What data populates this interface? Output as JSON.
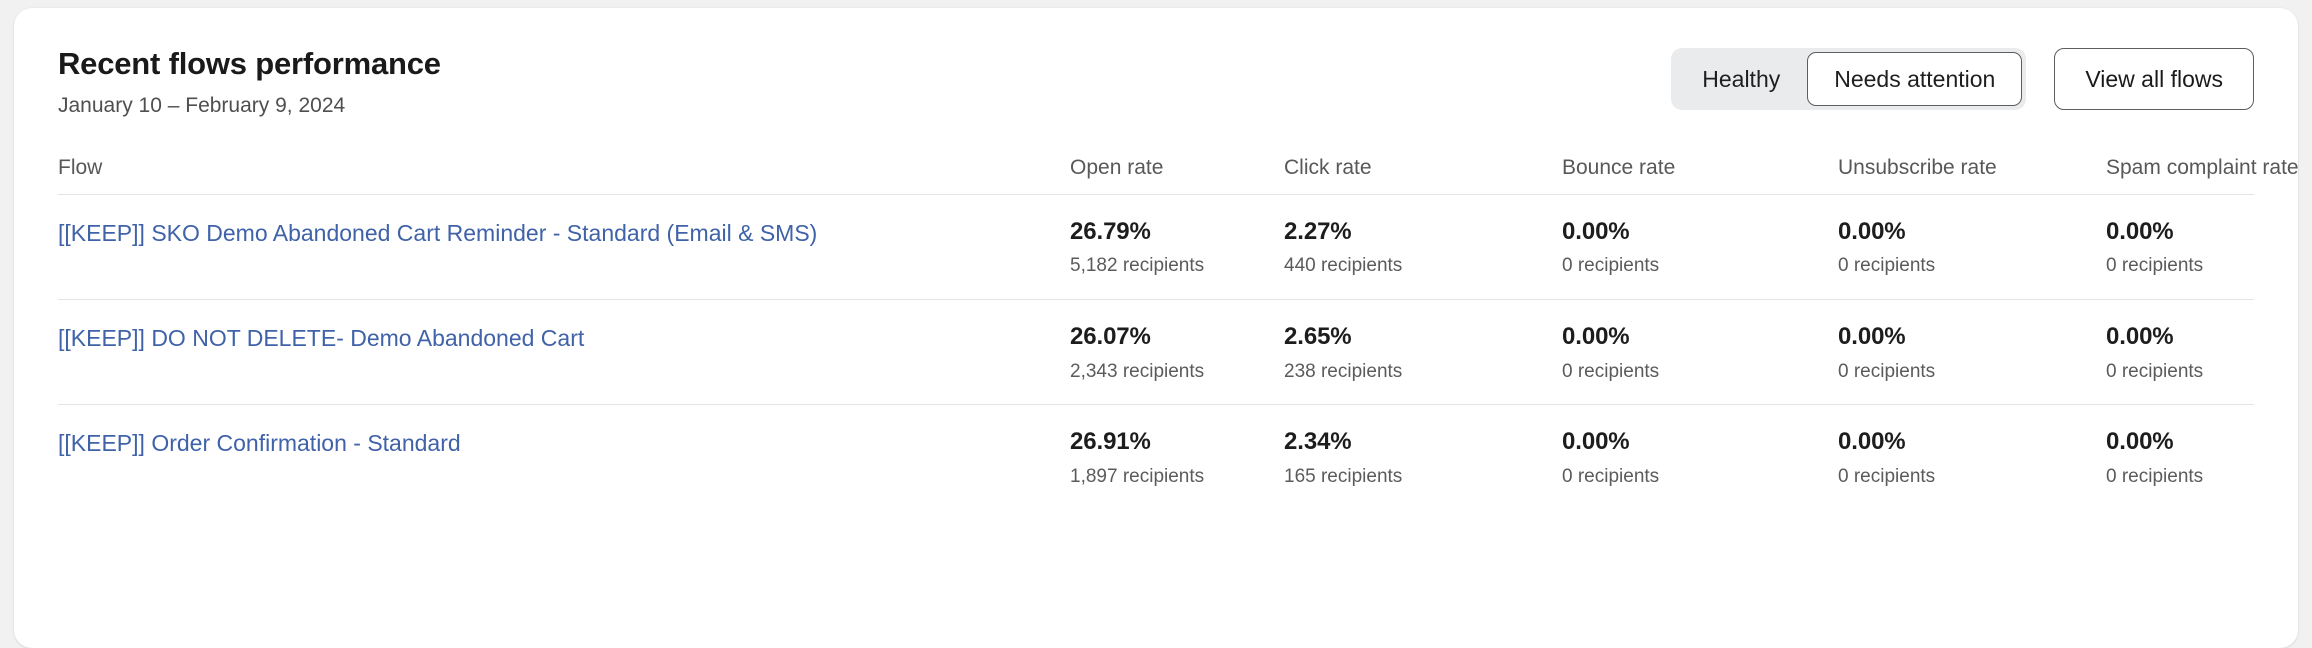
{
  "card": {
    "title": "Recent flows performance",
    "subtitle": "January 10 – February 9, 2024"
  },
  "controls": {
    "segmented": {
      "options": [
        "Healthy",
        "Needs attention"
      ],
      "selected": "Needs attention",
      "healthy_label": "Healthy",
      "needs_attention_label": "Needs attention"
    },
    "view_all_label": "View all flows"
  },
  "table": {
    "headers": {
      "flow": "Flow",
      "open_rate": "Open rate",
      "click_rate": "Click rate",
      "bounce_rate": "Bounce rate",
      "unsubscribe_rate": "Unsubscribe rate",
      "spam_complaint_rate": "Spam complaint rate"
    },
    "rows": [
      {
        "flow": "[[KEEP]] SKO Demo Abandoned Cart Reminder - Standard (Email & SMS)",
        "open_rate": "26.79%",
        "open_recipients": "5,182 recipients",
        "click_rate": "2.27%",
        "click_recipients": "440 recipients",
        "bounce_rate": "0.00%",
        "bounce_recipients": "0 recipients",
        "unsubscribe_rate": "0.00%",
        "unsubscribe_recipients": "0 recipients",
        "spam_rate": "0.00%",
        "spam_recipients": "0 recipients"
      },
      {
        "flow": "[[KEEP]] DO NOT DELETE- Demo Abandoned Cart",
        "open_rate": "26.07%",
        "open_recipients": "2,343 recipients",
        "click_rate": "2.65%",
        "click_recipients": "238 recipients",
        "bounce_rate": "0.00%",
        "bounce_recipients": "0 recipients",
        "unsubscribe_rate": "0.00%",
        "unsubscribe_recipients": "0 recipients",
        "spam_rate": "0.00%",
        "spam_recipients": "0 recipients"
      },
      {
        "flow": "[[KEEP]] Order Confirmation - Standard",
        "open_rate": "26.91%",
        "open_recipients": "1,897 recipients",
        "click_rate": "2.34%",
        "click_recipients": "165 recipients",
        "bounce_rate": "0.00%",
        "bounce_recipients": "0 recipients",
        "unsubscribe_rate": "0.00%",
        "unsubscribe_recipients": "0 recipients",
        "spam_rate": "0.00%",
        "spam_recipients": "0 recipients"
      }
    ]
  },
  "colors": {
    "link": "#3f62a8",
    "card_bg": "#ffffff",
    "page_bg": "#f1f1f1",
    "divider": "#e4e4e4",
    "segment_track": "#eaebec",
    "border_strong": "#5d5d5d"
  }
}
